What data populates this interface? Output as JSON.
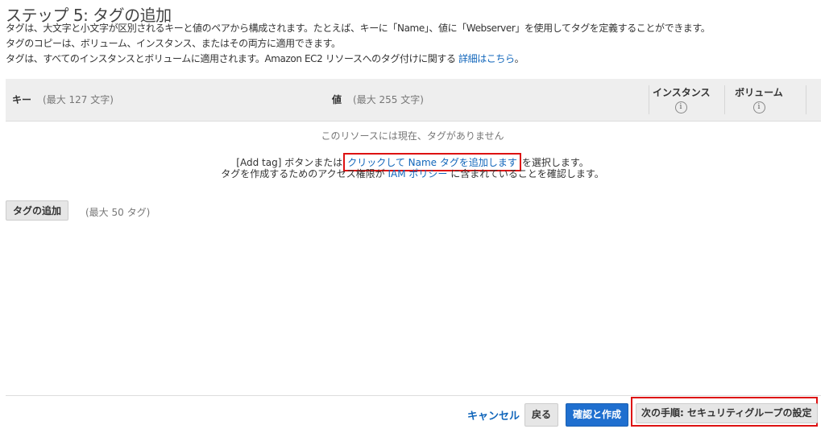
{
  "page": {
    "title": "ステップ 5: タグの追加",
    "desc1": "タグは、大文字と小文字が区別されるキーと値のペアから構成されます。たとえば、キーに「Name」、値に「Webserver」を使用してタグを定義することができます。",
    "desc2": "タグのコピーは、ボリューム、インスタンス、またはその両方に適用できます。",
    "desc3_text": "タグは、すべてのインスタンスとボリュームに適用されます。Amazon EC2 リソースへのタグ付けに関する",
    "desc3_link": "詳細はこちら",
    "desc3_end": "。"
  },
  "table": {
    "key_label": "キー",
    "key_hint": "(最大 127 文字)",
    "value_label": "値",
    "value_hint": "(最大 255 文字)",
    "instances_label": "インスタンス",
    "volumes_label": "ボリューム",
    "info_glyph": "i"
  },
  "empty_state": {
    "message": "このリソースには現在、タグがありません",
    "line2_prefix": "[Add tag] ボタンまたは",
    "line2_link": "クリックして Name タグを追加します",
    "line2_suffix": "を選択します。",
    "line3_prefix": "タグを作成するためのアクセス権限が",
    "line3_link": "IAM ポリシー",
    "line3_suffix": "に含まれていることを確認します。"
  },
  "actions": {
    "add_tag_label": "タグの追加",
    "max_tags_hint": "(最大 50 タグ)"
  },
  "footer": {
    "cancel_label": "キャンセル",
    "back_label": "戻る",
    "review_launch_label": "確認と作成",
    "next_label": "次の手順: セキュリティグループの設定"
  },
  "colors": {
    "link": "#1166bb",
    "primary_button": "#1f6fcf",
    "highlight": "#dd1111"
  }
}
